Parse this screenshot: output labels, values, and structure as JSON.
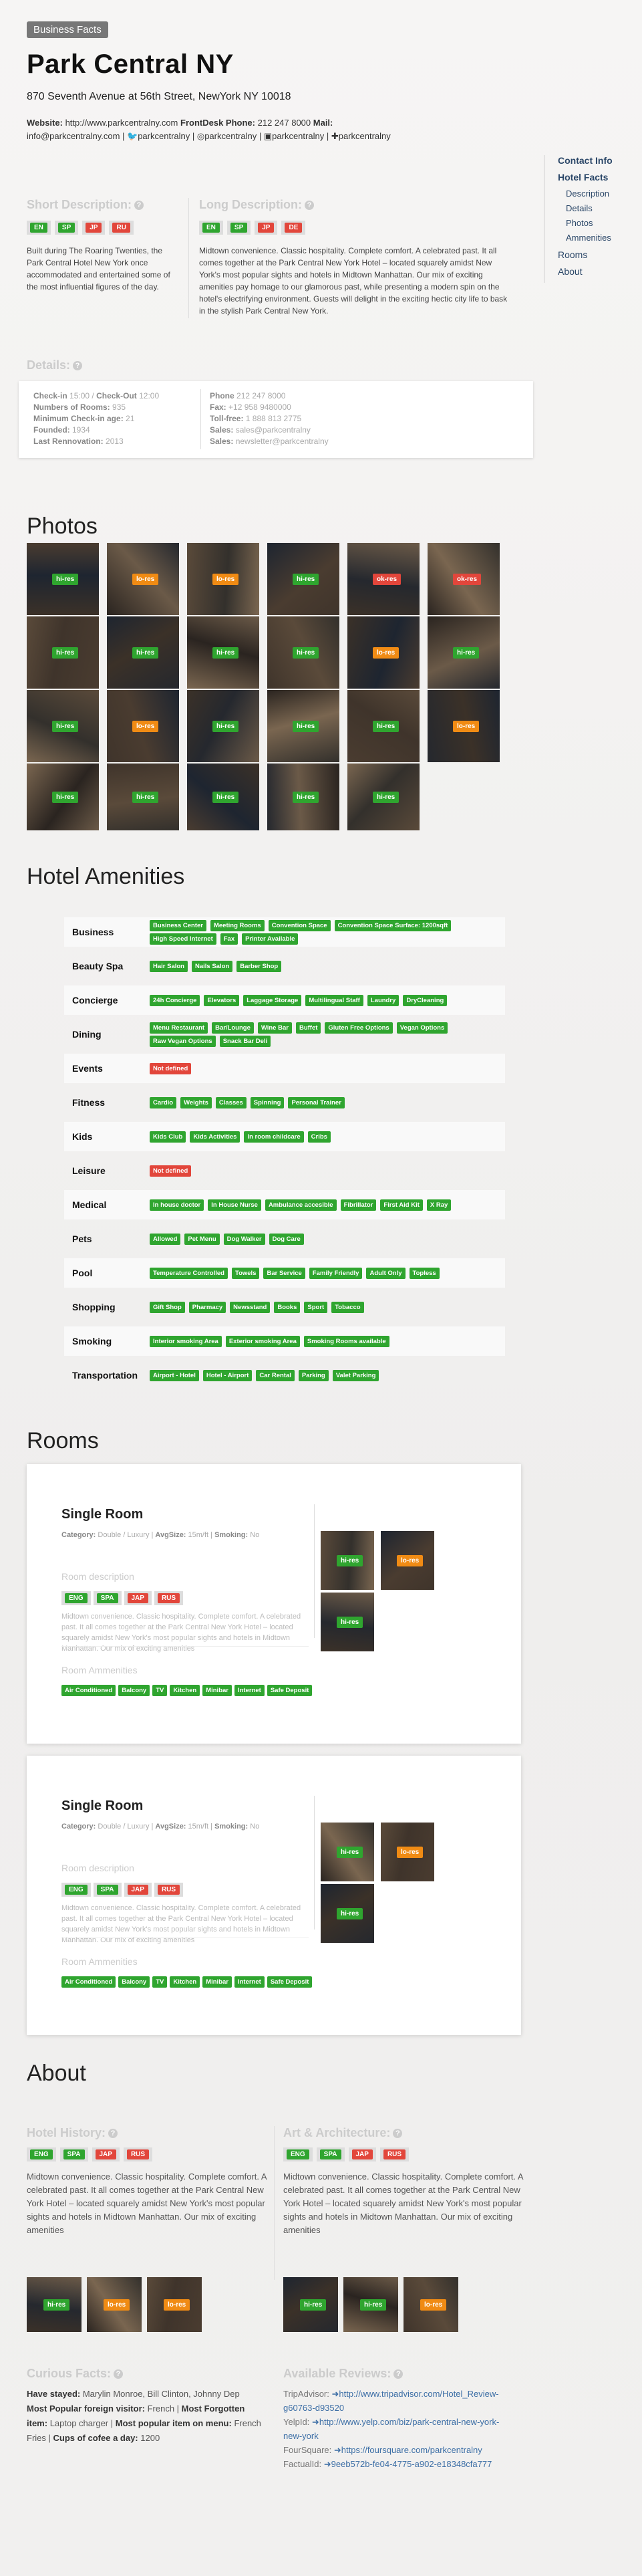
{
  "header": {
    "badge": "Business Facts",
    "title": "Park Central NY",
    "address": "870 Seventh Avenue at 56th Street, NewYork NY 10018"
  },
  "contacts": {
    "website_label": "Website:",
    "website": "http://www.parkcentralny.com",
    "frontdesk_label": "FrontDesk Phone:",
    "frontdesk": "212 247 8000",
    "mail_label": "Mail:",
    "mail": "info@parkcentralny.com",
    "twitter": "parkcentralny",
    "instagram": "parkcentralny",
    "linkedin": "parkcentralny",
    "googleplus": "parkcentralny"
  },
  "sidebar": {
    "contact": "Contact Info",
    "hotel_facts": "Hotel Facts",
    "description": "Description",
    "details": "Details",
    "photos": "Photos",
    "amenities": "Ammenities",
    "rooms": "Rooms",
    "about": "About"
  },
  "short_desc": {
    "label": "Short Description:",
    "q": "?",
    "text": "Built during The Roaring Twenties, the Park Central Hotel New York once accommodated and entertained some of the most influential figures of the day.",
    "langs": [
      "EN",
      "SP",
      "JP",
      "RU"
    ]
  },
  "long_desc": {
    "label": "Long Description:",
    "q": "?",
    "text": "Midtown convenience. Classic hospitality. Complete comfort. A celebrated past. It all comes together at the Park Central New York Hotel – located squarely amidst New York's most popular sights and hotels in Midtown Manhattan. Our mix of exciting amenities pay homage to our glamorous past, while presenting a modern spin on the hotel's electrifying environment. Guests will delight in the exciting hectic city life to bask in the stylish Park Central New York.",
    "langs": [
      "EN",
      "SP",
      "JP",
      "DE"
    ]
  },
  "details": {
    "label": "Details:",
    "q": "?",
    "left": [
      {
        "k": "Check-in",
        "v": "15:00"
      },
      {
        "k": "Check-Out",
        "v": "12:00"
      },
      {
        "k": "Numbers of Rooms:",
        "v": "935"
      },
      {
        "k": "Minimum Check-in age:",
        "v": "21"
      },
      {
        "k": "Founded:",
        "v": "1934"
      },
      {
        "k": "Last Rennovation:",
        "v": "2013"
      }
    ],
    "right": [
      {
        "k": "Phone",
        "v": "212 247 8000"
      },
      {
        "k": "Fax:",
        "v": "+12 958 9480000"
      },
      {
        "k": "Toll-free:",
        "v": "1 888 813 2775"
      },
      {
        "k": "Sales:",
        "v": "sales@parkcentralny"
      },
      {
        "k": "Sales:",
        "v": "newsletter@parkcentralny"
      }
    ]
  },
  "photos": {
    "title": "Photos",
    "tags": [
      "hi-res",
      "lo-res",
      "lo-res",
      "hi-res",
      "ok-res",
      "ok-res",
      "hi-res",
      "hi-res",
      "hi-res",
      "hi-res",
      "lo-res",
      "hi-res",
      "hi-res",
      "lo-res",
      "hi-res",
      "hi-res",
      "hi-res",
      "lo-res",
      "hi-res",
      "hi-res",
      "hi-res",
      "hi-res",
      "hi-res",
      "hi-res",
      "hi-res"
    ]
  },
  "amenities": {
    "title": "Hotel Amenities",
    "rows": [
      {
        "name": "Business",
        "tags": [
          "Business Center",
          "Meeting Rooms",
          "Convention Space",
          "Convention Space Surface: 1200sqft",
          "High Speed Internet",
          "Fax",
          "Printer Available"
        ]
      },
      {
        "name": "Beauty Spa",
        "tags": [
          "Hair Salon",
          "Nails Salon",
          "Barber Shop"
        ]
      },
      {
        "name": "Concierge",
        "tags": [
          "24h Concierge",
          "Elevators",
          "Laggage Storage",
          "Multilingual Staff",
          "Laundry",
          "DryCleaning"
        ]
      },
      {
        "name": "Dining",
        "tags": [
          "Menu Restaurant",
          "Bar/Lounge",
          "Wine Bar",
          "Buffet",
          "Gluten Free Options",
          "Vegan Options",
          "Raw Vegan Options",
          "Snack Bar Deli"
        ]
      },
      {
        "name": "Events",
        "tags": [
          "Not defined"
        ]
      },
      {
        "name": "Fitness",
        "tags": [
          "Cardio",
          "Weights",
          "Classes",
          "Spinning",
          "Personal Trainer"
        ]
      },
      {
        "name": "Kids",
        "tags": [
          "Kids Club",
          "Kids Activities",
          "In room childcare",
          "Cribs"
        ]
      },
      {
        "name": "Leisure",
        "tags": [
          "Not defined"
        ]
      },
      {
        "name": "Medical",
        "tags": [
          "In house doctor",
          "In House Nurse",
          "Ambulance accesible",
          "Fibrillator",
          "First Aid Kit",
          "X Ray"
        ]
      },
      {
        "name": "Pets",
        "tags": [
          "Allowed",
          "Pet Menu",
          "Dog Walker",
          "Dog Care"
        ]
      },
      {
        "name": "Pool",
        "tags": [
          "Temperature Controlled",
          "Towels",
          "Bar Service",
          "Family Friendly",
          "Adult Only",
          "Topless"
        ]
      },
      {
        "name": "Shopping",
        "tags": [
          "Gift Shop",
          "Pharmacy",
          "Newsstand",
          "Books",
          "Sport",
          "Tobacco"
        ]
      },
      {
        "name": "Smoking",
        "tags": [
          "Interior smoking Area",
          "Exterior smoking Area",
          "Smoking Rooms available"
        ]
      },
      {
        "name": "Transportation",
        "tags": [
          "Airport - Hotel",
          "Hotel - Airport",
          "Car Rental",
          "Parking",
          "Valet Parking"
        ]
      }
    ]
  },
  "rooms": {
    "title": "Rooms",
    "items": [
      {
        "name": "Single Room",
        "category_label": "Category:",
        "category": "Double / Luxury",
        "sqm_label": "AvgSize:",
        "sqm": "15m/ft",
        "smoking_label": "Smoking:",
        "smoking": "No",
        "desc_label": "Room description",
        "desc": "Midtown convenience. Classic hospitality. Complete comfort. A celebrated past. It all comes together at the Park Central New York Hotel – located squarely amidst New York's most popular sights and hotels in Midtown Manhattan. Our mix of exciting amenities",
        "langs": [
          "ENG",
          "SPA",
          "JAP",
          "RUS"
        ],
        "amen_label": "Room Ammenities",
        "amen": [
          "Air Conditioned",
          "Balcony",
          "TV",
          "Kitchen",
          "Minibar",
          "Internet",
          "Safe Deposit"
        ],
        "tags": [
          "hi-res",
          "lo-res",
          "hi-res"
        ]
      },
      {
        "name": "Single Room",
        "category_label": "Category:",
        "category": "Double / Luxury",
        "sqm_label": "AvgSize:",
        "sqm": "15m/ft",
        "smoking_label": "Smoking:",
        "smoking": "No",
        "desc_label": "Room description",
        "desc": "Midtown convenience. Classic hospitality. Complete comfort. A celebrated past. It all comes together at the Park Central New York Hotel – located squarely amidst New York's most popular sights and hotels in Midtown Manhattan. Our mix of exciting amenities",
        "langs": [
          "ENG",
          "SPA",
          "JAP",
          "RUS"
        ],
        "amen_label": "Room Ammenities",
        "amen": [
          "Air Conditioned",
          "Balcony",
          "TV",
          "Kitchen",
          "Minibar",
          "Internet",
          "Safe Deposit"
        ],
        "tags": [
          "hi-res",
          "lo-res",
          "hi-res"
        ]
      }
    ]
  },
  "about": {
    "title": "About",
    "history": {
      "label": "Hotel History:",
      "q": "?",
      "langs": [
        "ENG",
        "SPA",
        "JAP",
        "RUS"
      ],
      "text": "Midtown convenience. Classic hospitality. Complete comfort. A celebrated past. It all comes together at the Park Central New York Hotel – located squarely amidst New York's most popular sights and hotels in Midtown Manhattan. Our mix of exciting amenities",
      "tags": [
        "hi-res",
        "lo-res",
        "lo-res"
      ]
    },
    "art": {
      "label": "Art & Architecture:",
      "q": "?",
      "langs": [
        "ENG",
        "SPA",
        "JAP",
        "RUS"
      ],
      "text": "Midtown convenience. Classic hospitality. Complete comfort. A celebrated past. It all comes together at the Park Central New York Hotel – located squarely amidst New York's most popular sights and hotels in Midtown Manhattan. Our mix of exciting amenities",
      "tags": [
        "hi-res",
        "hi-res",
        "lo-res"
      ]
    },
    "facts": {
      "label": "Curious Facts:",
      "q": "?",
      "stayed_label": "Have stayed:",
      "stayed": "Marylin Monroe, Bill Clinton, Johnny Dep",
      "visitor_label": "Most Popular foreign visitor:",
      "visitor": "French",
      "forgotten_label": "Most Forgotten item:",
      "forgotten": "Laptop charger",
      "menu_label": "Most popular item on menu:",
      "menu": "French Fries",
      "coffee_label": "Cups of cofee a day:",
      "coffee": "1200"
    },
    "reviews": {
      "label": "Available Reviews:",
      "q": "?",
      "ta_label": "TripAdvisor:",
      "ta": "http://www.tripadvisor.com/Hotel_Review-g60763-d93520",
      "yelp_label": "YelpId:",
      "yelp": "http://www.yelp.com/biz/park-central-new-york-new-york",
      "fs_label": "FourSquare:",
      "fs": "https://foursquare.com/parkcentralny",
      "fact_label": "FactualId:",
      "fact": "9eeb572b-fe04-4775-a902-e18348cfa777"
    }
  }
}
